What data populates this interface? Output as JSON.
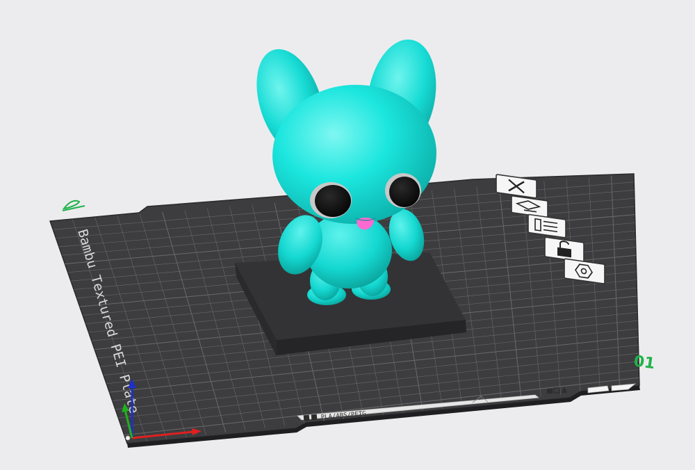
{
  "viewport": {
    "background_color": "#ececee"
  },
  "plate": {
    "bed_name": "Bambu Textured PEI Plate",
    "plate_number": "01",
    "filament_compat": "PLA/ABS/PETG",
    "bed_color": "#3d3d3f",
    "grid_color": "#6a6a6c",
    "edge_color": "#2a2a2c",
    "label_color": "#d8d8d8",
    "accent_color": "#1fb24a"
  },
  "plate_toolbar": {
    "icons": [
      "close-icon",
      "arrange-icon",
      "orient-icon",
      "lock-icon",
      "settings-icon"
    ]
  },
  "model": {
    "name": "bunny figure",
    "body_color": "#19e2db",
    "base_color": "#333335",
    "eye_color": "#0c0c0c",
    "mouth_color": "#ff69d2"
  },
  "axes": {
    "x_color": "#e02020",
    "y_color": "#20b020",
    "z_color": "#1e30c8"
  }
}
